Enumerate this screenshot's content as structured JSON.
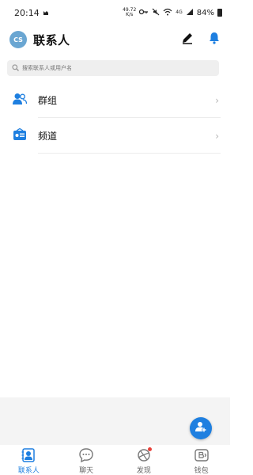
{
  "status_bar": {
    "time": "20:14",
    "speed_value": "49.72",
    "speed_unit": "K/s",
    "battery": "84%",
    "network": "4G"
  },
  "header": {
    "avatar_initials": "CS",
    "title": "联系人"
  },
  "search": {
    "placeholder": "搜索联系人或用户名"
  },
  "list": {
    "items": [
      {
        "label": "群组",
        "icon": "group-icon"
      },
      {
        "label": "频道",
        "icon": "channel-icon"
      }
    ]
  },
  "tabs": [
    {
      "label": "联系人",
      "icon": "contacts-icon",
      "active": true
    },
    {
      "label": "聊天",
      "icon": "chat-icon",
      "active": false
    },
    {
      "label": "发现",
      "icon": "discover-icon",
      "active": false,
      "badge": true
    },
    {
      "label": "钱包",
      "icon": "wallet-icon",
      "active": false
    }
  ],
  "colors": {
    "accent": "#1e7fe0",
    "avatar_bg": "#6aa6d2",
    "badge": "#e8413a"
  }
}
